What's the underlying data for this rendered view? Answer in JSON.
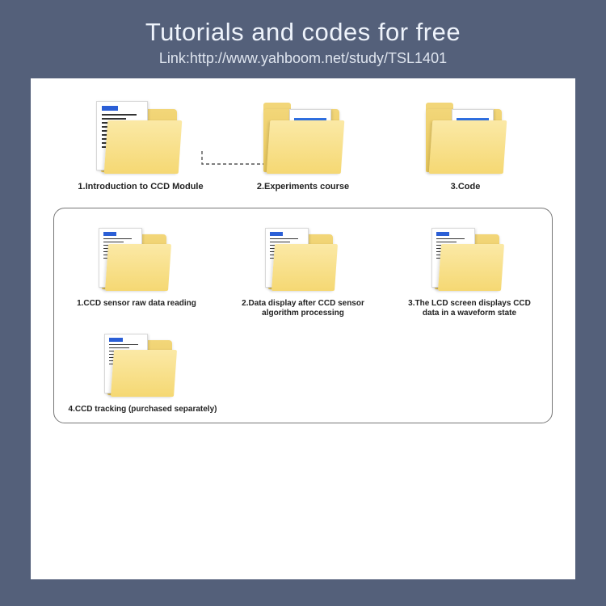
{
  "header": {
    "title": "Tutorials and codes for free",
    "subtitle": "Link:http://www.yahboom.net/study/TSL1401"
  },
  "top_row": [
    {
      "label": "1.Introduction to CCD Module"
    },
    {
      "label": "2.Experiments course"
    },
    {
      "label": "3.Code"
    }
  ],
  "sub_row1": [
    {
      "label": "1.CCD sensor raw data reading"
    },
    {
      "label": "2.Data display after CCD sensor algorithm processing"
    },
    {
      "label": "3.The LCD screen displays CCD data in a waveform state"
    }
  ],
  "sub_row2": [
    {
      "label": "4.CCD tracking (purchased separately)"
    }
  ]
}
